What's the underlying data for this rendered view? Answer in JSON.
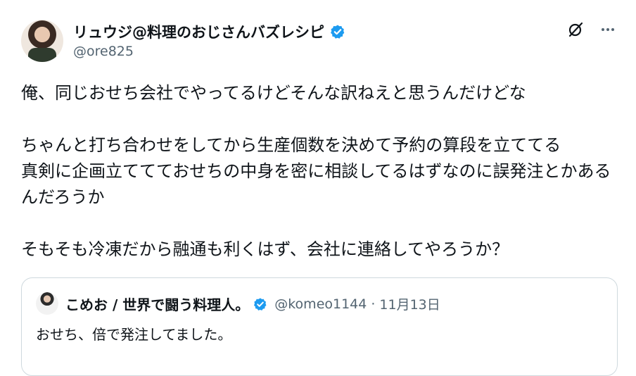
{
  "author": {
    "display_name": "リュウジ@料理のおじさんバズレシピ",
    "handle": "@ore825"
  },
  "tweet": {
    "text": "俺、同じおせち会社でやってるけどそんな訳ねえと思うんだけどな\n\nちゃんと打ち合わせをしてから生産個数を決めて予約の算段を立ててる\n真剣に企画立ててておせちの中身を密に相談してるはずなのに誤発注とかあるんだろうか\n\nそもそも冷凍だから融通も利くはず、会社に連絡してやろうか？"
  },
  "quoted": {
    "display_name": "こめお / 世界で闘う料理人。",
    "handle": "@komeo1144",
    "separator": "·",
    "date": "11月13日",
    "text": "おせち、倍で発注してました。"
  },
  "colors": {
    "verified": "#1d9bf0",
    "secondary_text": "#536471",
    "border": "#cfd9de"
  },
  "icons": [
    "grok-icon",
    "more-icon",
    "verified-badge-icon"
  ]
}
